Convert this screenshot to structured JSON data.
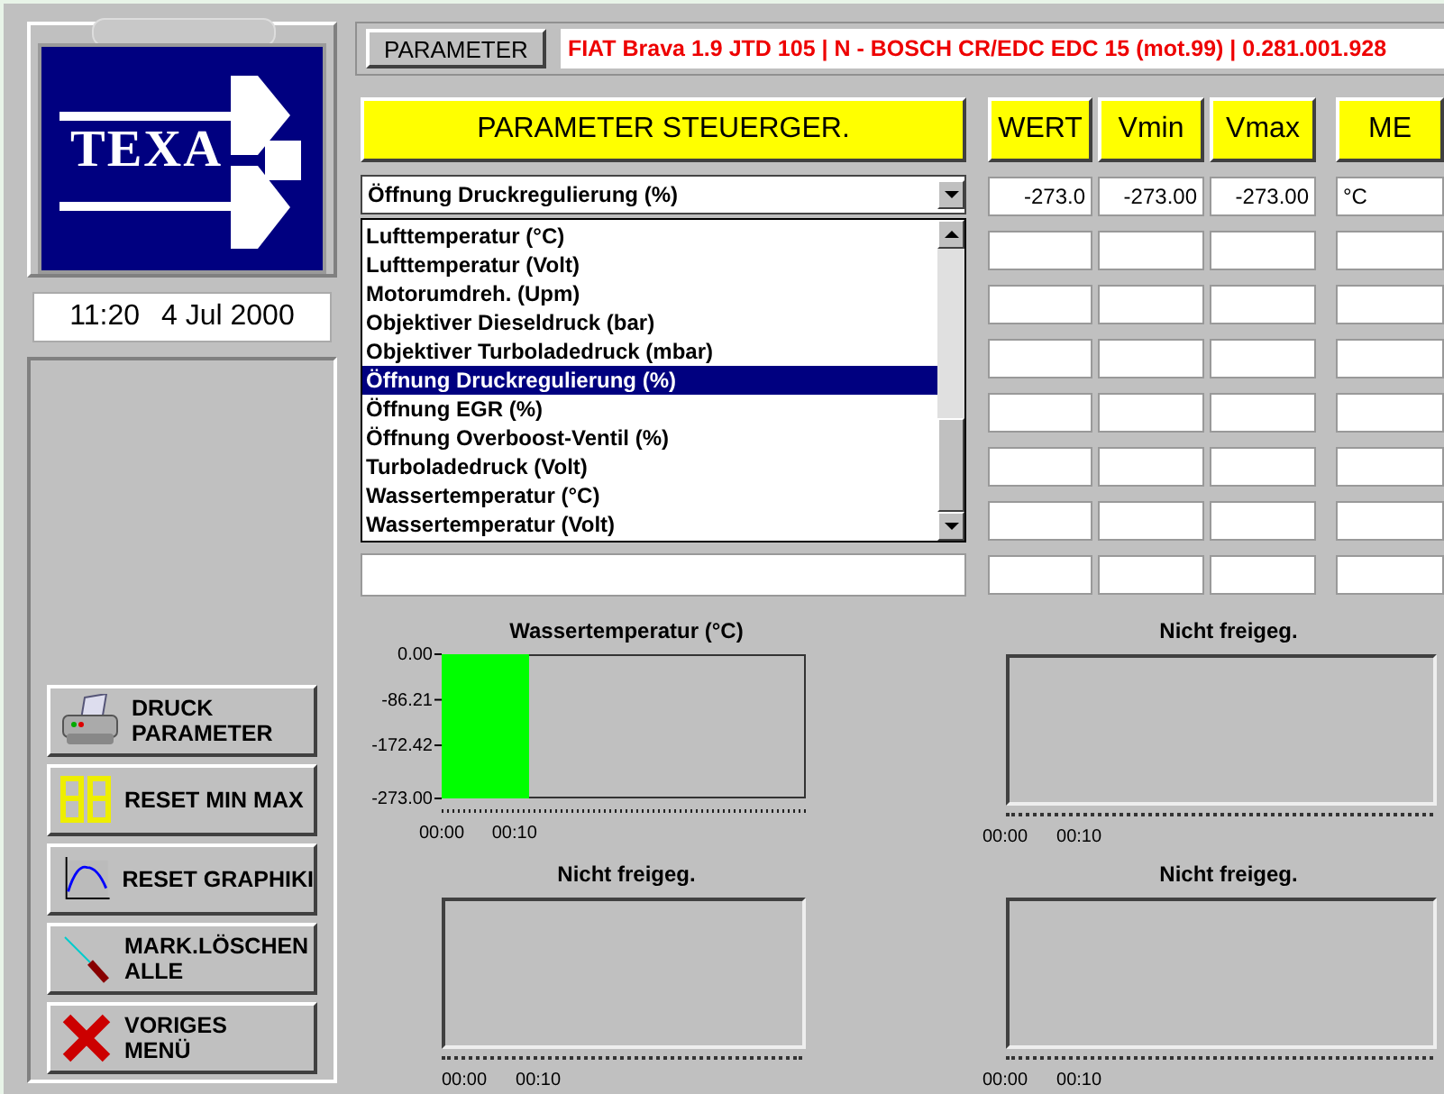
{
  "logo": {
    "text": "TEXA"
  },
  "clock": {
    "time": "11:20",
    "date": "4 Jul 2000"
  },
  "side_buttons": [
    {
      "kind": "printer",
      "lines": [
        "DRUCK",
        "PARAMETER"
      ]
    },
    {
      "kind": "digits",
      "lines": [
        "RESET MIN MAX"
      ]
    },
    {
      "kind": "graph",
      "lines": [
        "RESET GRAPHIKI"
      ]
    },
    {
      "kind": "marker",
      "lines": [
        "MARK.LÖSCHEN",
        "ALLE"
      ]
    },
    {
      "kind": "exit",
      "lines": [
        "VORIGES",
        "MENÜ"
      ]
    }
  ],
  "header": {
    "button": "PARAMETER",
    "vehicle": "FIAT Brava 1.9 JTD 105 | N - BOSCH CR/EDC EDC 15 (mot.99) | 0.281.001.928"
  },
  "parameter_heading": "PARAMETER STEUERGER.",
  "dropdown": {
    "value": "Öffnung Druckregulierung (%)"
  },
  "parameter_list": [
    {
      "label": "Lufttemperatur (°C)",
      "selected": false
    },
    {
      "label": "Lufttemperatur (Volt)",
      "selected": false
    },
    {
      "label": "Motorumdreh. (Upm)",
      "selected": false
    },
    {
      "label": "Objektiver Dieseldruck (bar)",
      "selected": false
    },
    {
      "label": "Objektiver Turboladedruck (mbar)",
      "selected": false
    },
    {
      "label": "Öffnung Druckregulierung (%)",
      "selected": true
    },
    {
      "label": "Öffnung EGR (%)",
      "selected": false
    },
    {
      "label": "Öffnung Overboost-Ventil (%)",
      "selected": false
    },
    {
      "label": "Turboladedruck (Volt)",
      "selected": false
    },
    {
      "label": "Wassertemperatur (°C)",
      "selected": false
    },
    {
      "label": "Wassertemperatur (Volt)",
      "selected": false
    }
  ],
  "table": {
    "columns": [
      "WERT",
      "Vmin",
      "Vmax",
      "ME"
    ],
    "rows": [
      [
        "-273.0",
        "-273.00",
        "-273.00",
        "°C"
      ]
    ]
  },
  "charts": [
    {
      "kind": "data",
      "chart_data": {
        "type": "area",
        "x": [
          0,
          12
        ],
        "series": [
          {
            "name": "Wassertemperatur (°C)",
            "color": "#00ff00",
            "values": [
              -273,
              -273
            ]
          }
        ],
        "xlim": [
          0,
          50
        ],
        "ylim": [
          -273,
          0
        ],
        "xticks": [
          {
            "value": 0,
            "label": "00:00"
          },
          {
            "value": 10,
            "label": "00:10"
          }
        ],
        "yticks": [
          {
            "value": 0,
            "label": "0.00"
          },
          {
            "value": -86.21,
            "label": "-86.21"
          },
          {
            "value": -172.42,
            "label": "-172.42"
          },
          {
            "value": -273,
            "label": "-273.00"
          }
        ]
      }
    },
    {
      "kind": "empty",
      "title": "Nicht freigeg.",
      "x_labels": [
        "00:00",
        "00:10"
      ]
    },
    {
      "kind": "empty",
      "title": "Nicht freigeg.",
      "x_labels": [
        "00:00",
        "00:10"
      ]
    },
    {
      "kind": "empty",
      "title": "Nicht freigeg.",
      "x_labels": [
        "00:00",
        "00:10"
      ]
    }
  ]
}
